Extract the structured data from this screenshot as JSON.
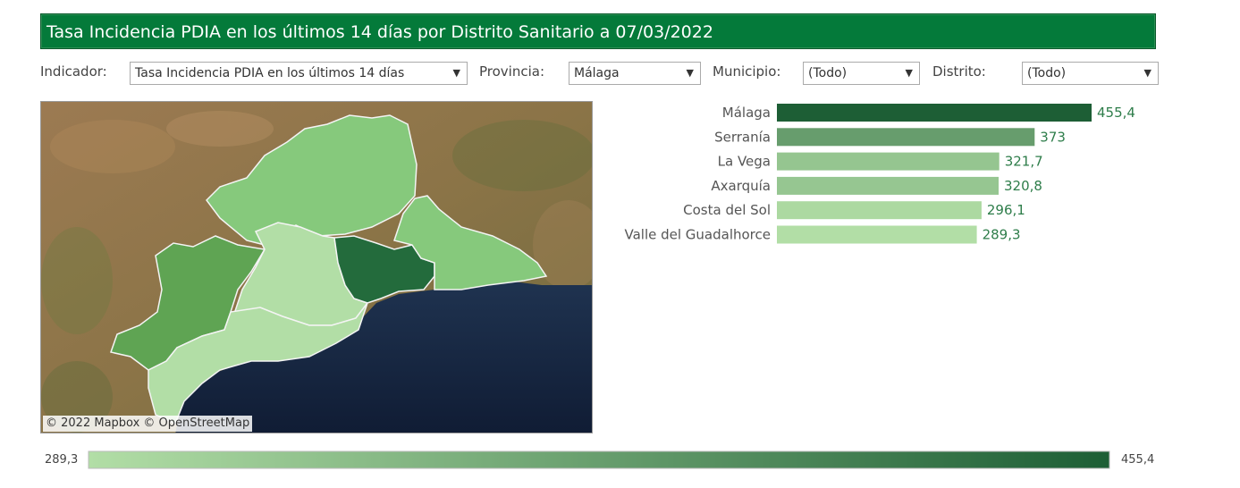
{
  "title": "Tasa Incidencia PDIA en los últimos 14 días por Distrito Sanitario a 07/03/2022",
  "filters": {
    "indicador": {
      "label": "Indicador:",
      "value": "Tasa Incidencia PDIA en los últimos 14 días"
    },
    "provincia": {
      "label": "Provincia:",
      "value": "Málaga"
    },
    "municipio": {
      "label": "Municipio:",
      "value": "(Todo)"
    },
    "distrito": {
      "label": "Distrito:",
      "value": "(Todo)"
    }
  },
  "map": {
    "attribution": "© 2022 Mapbox  © OpenStreetMap"
  },
  "colors": {
    "title_bg": "#047a3a",
    "scale_low": "#b2dea6",
    "scale_high": "#1d5e35",
    "value_text": "#2e7d4a"
  },
  "chart_data": {
    "type": "bar",
    "orientation": "horizontal",
    "categories": [
      "Málaga",
      "Serranía",
      "La Vega",
      "Axarquía",
      "Costa del Sol",
      "Valle del Guadalhorce"
    ],
    "values": [
      455.4,
      373,
      321.7,
      320.8,
      296.1,
      289.3
    ],
    "value_labels": [
      "455,4",
      "373",
      "321,7",
      "320,8",
      "296,1",
      "289,3"
    ],
    "xlim": [
      0,
      455.4
    ],
    "color_legend": {
      "min_label": "289,3",
      "max_label": "455,4",
      "range": [
        289.3,
        455.4
      ]
    }
  }
}
